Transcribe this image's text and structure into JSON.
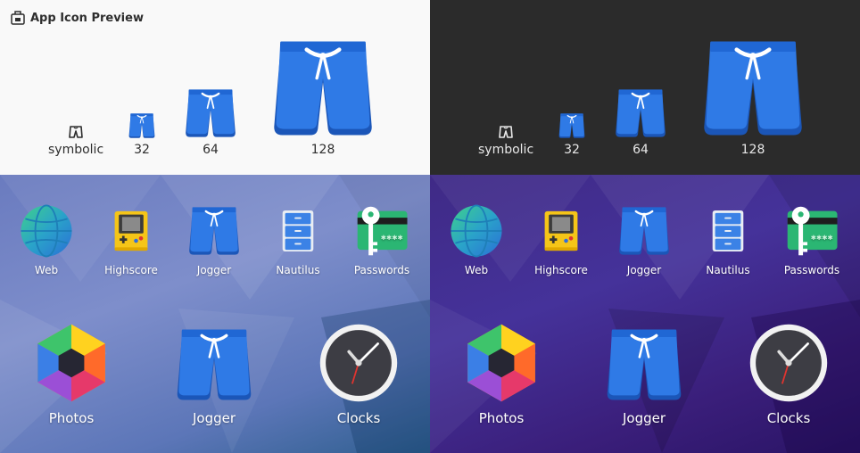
{
  "preview": {
    "title": "App Icon Preview",
    "sizes": [
      {
        "label": "symbolic"
      },
      {
        "label": "32"
      },
      {
        "label": "64"
      },
      {
        "label": "128"
      }
    ]
  },
  "grid": {
    "small_apps": [
      {
        "label": "Web",
        "icon": "web-globe-icon"
      },
      {
        "label": "Highscore",
        "icon": "game-console-icon"
      },
      {
        "label": "Jogger",
        "icon": "shorts-icon"
      },
      {
        "label": "Nautilus",
        "icon": "file-cabinet-icon"
      },
      {
        "label": "Passwords",
        "icon": "key-card-icon"
      }
    ],
    "large_apps": [
      {
        "label": "Photos",
        "icon": "photos-hexagon-icon"
      },
      {
        "label": "Jogger",
        "icon": "shorts-icon"
      },
      {
        "label": "Clocks",
        "icon": "clock-icon"
      }
    ]
  },
  "colors": {
    "shorts_blue": "#2a72e0",
    "shorts_dark_blue": "#1b56b8",
    "light_bg": "#f9f9f9",
    "dark_bg": "#2b2b2b"
  }
}
